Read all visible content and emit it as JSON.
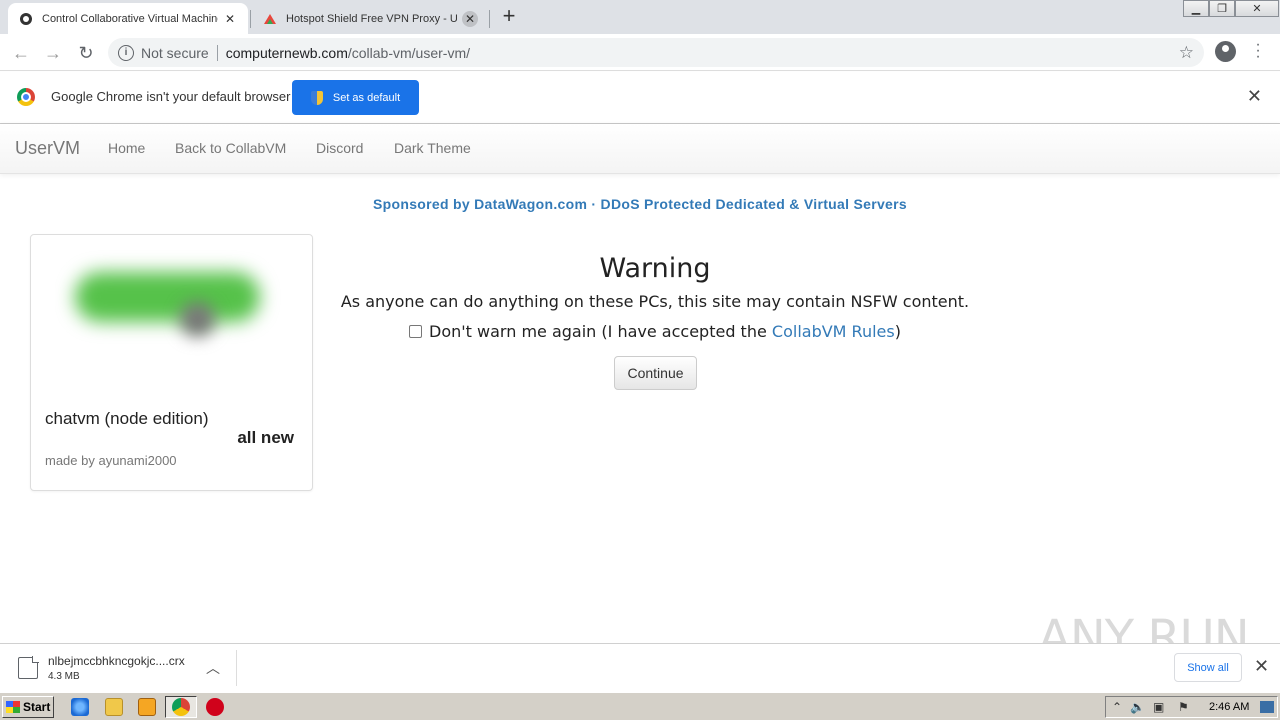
{
  "browser": {
    "tabs": [
      {
        "title": "Control Collaborative Virtual Machine",
        "favicon": "collabvm-favicon",
        "active": true
      },
      {
        "title": "Hotspot Shield Free VPN Proxy - Unli",
        "favicon": "hotspot-favicon",
        "active": false
      }
    ],
    "url": {
      "security_label": "Not secure",
      "host": "computernewb.com",
      "path": "/collab-vm/user-vm/"
    },
    "infobar": {
      "message": "Google Chrome isn't your default browser",
      "button_label": "Set as default"
    },
    "colors": {
      "accent": "#1a73e8",
      "link": "#337ab7"
    }
  },
  "page": {
    "navbar": {
      "brand": "UserVM",
      "links": [
        "Home",
        "Back to CollabVM",
        "Discord",
        "Dark Theme"
      ]
    },
    "sponsor": "Sponsored by DataWagon.com · DDoS Protected Dedicated & Virtual Servers",
    "vm_card": {
      "name": "chatvm (node edition)",
      "badge": "all new",
      "author": "made by ayunami2000"
    },
    "warning": {
      "title": "Warning",
      "message": "As anyone can do anything on these PCs, this site may contain NSFW content.",
      "checkbox_prefix": "Don't warn me again (I have accepted the ",
      "rules_link": "CollabVM Rules",
      "checkbox_suffix": ")",
      "checkbox_checked": false,
      "continue_label": "Continue"
    }
  },
  "downloads": {
    "file_name": "nlbejmccbhkncgokjc....crx",
    "file_size": "4.3 MB",
    "show_all_label": "Show all"
  },
  "watermark": "ANY RUN",
  "taskbar": {
    "start_label": "Start",
    "clock": "2:46 AM"
  }
}
